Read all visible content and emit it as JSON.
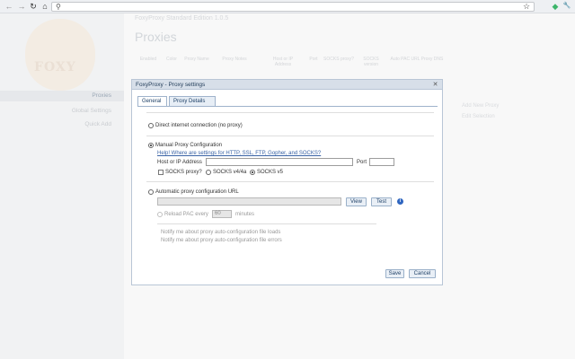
{
  "chrome": {
    "back_icon": "back-arrow-icon",
    "forward_icon": "forward-arrow-icon",
    "reload_icon": "reload-icon",
    "home_icon": "home-icon",
    "search_icon": "search-icon",
    "star_icon": "star-icon",
    "extension_icon": "foxyproxy-extension-icon",
    "wrench_icon": "wrench-icon",
    "glyphs": {
      "back": "←",
      "forward": "→",
      "reload": "↻",
      "home": "⌂",
      "search": "⚲",
      "star": "☆",
      "extension": "◆",
      "wrench": "🔧"
    }
  },
  "background_page": {
    "logo_text": "FOXY",
    "nav_items": [
      {
        "label": "Proxies",
        "selected": true
      },
      {
        "label": "Global Settings",
        "selected": false
      },
      {
        "label": "Quick Add",
        "selected": false
      }
    ],
    "breadcrumb": "FoxyProxy Standard Edition 1.0.5",
    "page_title": "Proxies",
    "column_headers": [
      "Enabled",
      "Color",
      "Proxy Name",
      "Proxy Notes",
      "Host or IP Address",
      "Port",
      "SOCKS proxy?",
      "SOCKS version",
      "Auto PAC URL",
      "Proxy DNS"
    ],
    "right_links": [
      "Add New Proxy",
      "Edit Selection"
    ]
  },
  "dialog": {
    "title": "FoxyProxy - Proxy settings",
    "close_glyph": "✕",
    "tabs": [
      {
        "label": "General",
        "selected": true
      },
      {
        "label": "Proxy Details",
        "selected": false
      }
    ],
    "direct_label": "Direct internet connection (no proxy)",
    "manual_label": "Manual Proxy Configuration",
    "help_link": "Help! Where are settings for HTTP, SSL, FTP, Gopher, and SOCKS?",
    "host_label": "Host or IP Address",
    "host_value": "",
    "port_label": "Port",
    "port_value": "",
    "socks_proxy_label": "SOCKS proxy?",
    "socks4_label": "SOCKS v4/4a",
    "socks5_label": "SOCKS v5",
    "auto_label": "Automatic proxy configuration URL",
    "pac_url_value": "",
    "view_button": "View",
    "test_button": "Test",
    "info_glyph": "i",
    "reload_pac_label": "Reload PAC every",
    "reload_pac_value": "60",
    "minutes_label": "minutes",
    "notify_load_label": "Notify me about proxy auto-configuration file loads",
    "notify_error_label": "Notify me about proxy auto-configuration file errors",
    "save_button": "Save",
    "cancel_button": "Cancel"
  }
}
